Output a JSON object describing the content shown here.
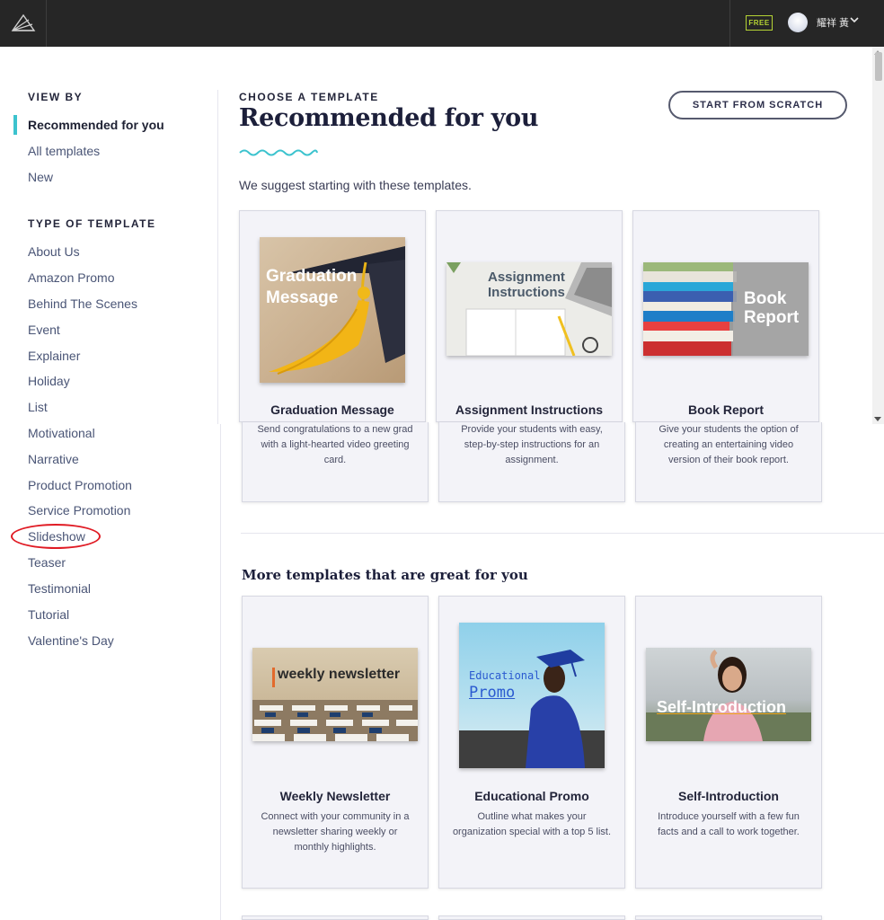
{
  "header": {
    "plan_badge": "FREE",
    "user_name": "耀祥 黃",
    "icons": [
      "logo-icon",
      "avatar",
      "chevron-down-icon"
    ]
  },
  "sidebar": {
    "view_by_heading": "VIEW BY",
    "view_by_items": [
      {
        "label": "Recommended for you",
        "active": true
      },
      {
        "label": "All templates"
      },
      {
        "label": "New"
      }
    ],
    "type_heading": "TYPE OF TEMPLATE",
    "type_items": [
      {
        "label": "About Us"
      },
      {
        "label": "Amazon Promo"
      },
      {
        "label": "Behind The Scenes"
      },
      {
        "label": "Event"
      },
      {
        "label": "Explainer"
      },
      {
        "label": "Holiday"
      },
      {
        "label": "List"
      },
      {
        "label": "Motivational"
      },
      {
        "label": "Narrative"
      },
      {
        "label": "Product Promotion"
      },
      {
        "label": "Service Promotion"
      },
      {
        "label": "Slideshow",
        "annotated": true
      },
      {
        "label": "Teaser"
      },
      {
        "label": "Testimonial"
      },
      {
        "label": "Tutorial"
      },
      {
        "label": "Valentine's Day"
      }
    ]
  },
  "main": {
    "eyebrow": "CHOOSE A TEMPLATE",
    "title": "Recommended for you",
    "start_button": "START FROM SCRATCH",
    "suggest_text": "We suggest starting with these templates.",
    "recommended": [
      {
        "title": "Graduation Message",
        "thumb_lines": [
          "Graduation",
          "Message"
        ],
        "desc_lines": [
          "Send congratulations to a new grad",
          "with a light-hearted video greeting",
          "card."
        ]
      },
      {
        "title": "Assignment Instructions",
        "thumb_lines": [
          "Assignment",
          "Instructions"
        ],
        "desc_lines": [
          "Provide your students with easy,",
          "step-by-step instructions for an",
          "assignment."
        ]
      },
      {
        "title": "Book Report",
        "thumb_lines": [
          "Book",
          "Report"
        ],
        "desc_lines": [
          "Give your students the option of",
          "creating an entertaining video",
          "version of their book report."
        ]
      }
    ],
    "more_title": "More templates that are great for you",
    "more": [
      {
        "title": "Weekly Newsletter",
        "thumb_lines": [
          "weekly newsletter"
        ],
        "desc_lines": [
          "Connect with your community in a",
          "newsletter sharing weekly or",
          "monthly highlights."
        ]
      },
      {
        "title": "Educational Promo",
        "thumb_lines": [
          "Educational",
          "Promo"
        ],
        "desc_lines": [
          "Outline what makes your",
          "organization special with a top 5 list."
        ]
      },
      {
        "title": "Self-Introduction",
        "thumb_lines": [
          "Self-Introduction"
        ],
        "desc_lines": [
          "Introduce yourself with a few fun",
          "facts and a call to work together."
        ]
      }
    ]
  },
  "colors": {
    "topbar": "#262626",
    "accent_teal": "#3cc3ce",
    "badge_green": "#b5d334",
    "annotation_red": "#e01b24",
    "card_bg": "#f3f3f8"
  }
}
